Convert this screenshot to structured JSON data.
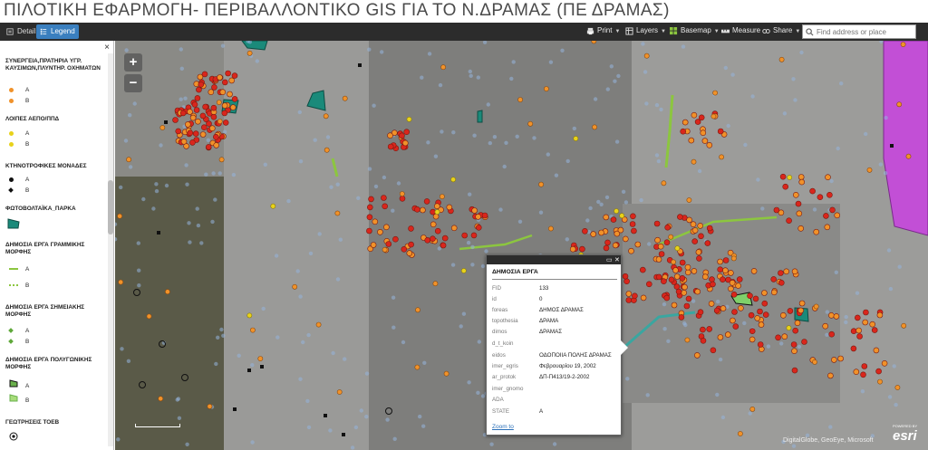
{
  "title": "ΠΙΛΟΤΙΚΗ ΕΦΑΡΜΟΓΗ- ΠΕΡΙΒΑΛΛΟΝΤΙΚΟ GIS ΓΙΑ ΤΟ Ν.ΔΡΑΜΑΣ (ΠΕ ΔΡΑΜΑΣ)",
  "tabs": [
    {
      "label": "Details",
      "active": false,
      "icon": "info-icon"
    },
    {
      "label": "Legend",
      "active": true,
      "icon": "legend-icon"
    }
  ],
  "tools": {
    "print": "Print",
    "layers": "Layers",
    "basemap": "Basemap",
    "measure": "Measure",
    "share": "Share"
  },
  "search": {
    "placeholder": "Find address or place"
  },
  "legend": {
    "close": "×",
    "groups": [
      {
        "heading": "ΣΥΝΕΡΓΕΙΑ,ΠΡΑΤΗΡΙΑ ΥΓΡ. ΚΑΥΣΙΜΩΝ,ΠΛΥΝΤΗΡ. ΟΧΗΜΑΤΩΝ",
        "items": [
          {
            "label": "A",
            "symbol": "orange-dot"
          },
          {
            "label": "B",
            "symbol": "orange-dot"
          }
        ]
      },
      {
        "heading": "ΛΟΙΠΕΣ ΑΕΠΟ/ΠΠΔ",
        "items": [
          {
            "label": "A",
            "symbol": "yellow-dot"
          },
          {
            "label": "B",
            "symbol": "yellow-dot"
          }
        ]
      },
      {
        "heading": "ΚΤΗΝΟΤΡΟΦΙΚΕΣ ΜΟΝΑΔΕΣ",
        "items": [
          {
            "label": "A",
            "symbol": "black-dot"
          },
          {
            "label": "B",
            "symbol": "black-diamond"
          }
        ]
      },
      {
        "heading": "ΦΩΤΟΒΟΛΤΑΪΚΑ_ΠΑΡΚΑ",
        "items": []
      },
      {
        "heading": "ΔΗΜΟΣΙΑ ΕΡΓΑ ΓΡΑΜΜΙΚΗΣ ΜΟΡΦΗΣ",
        "items": [
          {
            "label": "A",
            "symbol": "green-line"
          },
          {
            "label": "B",
            "symbol": "green-dashed-line"
          }
        ]
      },
      {
        "heading": "ΔΗΜΟΣΙΑ ΕΡΓΑ ΣΗΜΕΙΑΚΗΣ ΜΟΡΦΗΣ",
        "items": [
          {
            "label": "A",
            "symbol": "green-diamond"
          },
          {
            "label": "B",
            "symbol": "green-diamond"
          }
        ]
      },
      {
        "heading": "ΔΗΜΟΣΙΑ ΕΡΓΑ ΠΟΛΥΓΩΝΙΚΗΣ ΜΟΡΦΗΣ",
        "items": [
          {
            "label": "A",
            "symbol": "green-polygon-dark"
          },
          {
            "label": "B",
            "symbol": "green-polygon-light"
          }
        ]
      },
      {
        "heading": "ΓΕΩΤΡΗΣΕΙΣ ΤΟΕΒ",
        "items": []
      }
    ]
  },
  "map": {
    "zoom_in": "+",
    "zoom_out": "−",
    "attribution": "DigitalGlobe, GeoEye, Microsoft",
    "powered_by": "POWERED BY",
    "esri": "esri"
  },
  "popup": {
    "title": "ΔΗΜΟΣΙΑ ΕΡΓΑ",
    "fields": [
      {
        "name": "FID",
        "value": "133"
      },
      {
        "name": "id",
        "value": "0"
      },
      {
        "name": "foreas",
        "value": "ΔΗΜΟΣ ΔΡΑΜΑΣ"
      },
      {
        "name": "topothesia",
        "value": "ΔΡΑΜΑ"
      },
      {
        "name": "dimos",
        "value": "ΔΡΑΜΑΣ"
      },
      {
        "name": "d_t_koin",
        "value": ""
      },
      {
        "name": "eidos",
        "value": "ΟΔΟΠΟΙΙΑ ΠΟΛΗΣ ΔΡΑΜΑΣ"
      },
      {
        "name": "imer_egris",
        "value": "Φεβρουαρίου 19, 2002"
      },
      {
        "name": "ar_protok",
        "value": "ΔΠ-Π413/19-2-2002"
      },
      {
        "name": "imer_gnomo",
        "value": ""
      },
      {
        "name": "ADA",
        "value": ""
      },
      {
        "name": "STATE",
        "value": "A"
      }
    ],
    "zoom_to": "Zoom to"
  },
  "colors": {
    "toolbar": "#2c2c2c",
    "accent": "#3a7fbf",
    "orange": "#f0922a",
    "red": "#d9261c",
    "yellow": "#e8d21a",
    "green": "#8cc63f",
    "teal": "#1a8a7a",
    "purple": "#c24fd6"
  }
}
